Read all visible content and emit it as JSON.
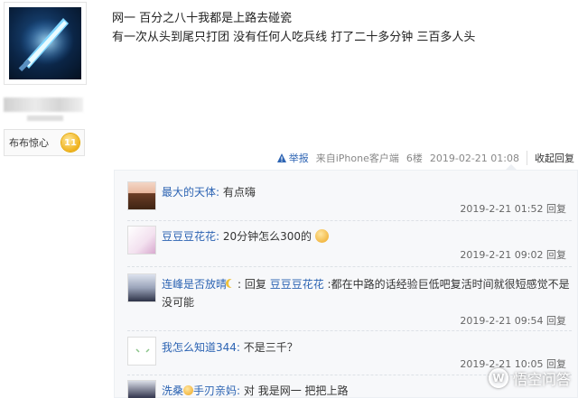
{
  "sidebar": {
    "fan_badge_label": "布布惊心",
    "fan_level": "11"
  },
  "post": {
    "lines": [
      "网一 百分之八十我都是上路去碰瓷",
      "有一次从头到尾只打团 没有任何人吃兵线 打了二十多分钟 三百多人头"
    ],
    "meta": {
      "report_label": "举报",
      "source": "来自iPhone客户端",
      "floor": "6楼",
      "time": "2019-02-21 01:08",
      "collapse_label": "收起回复"
    }
  },
  "replies": [
    {
      "user": "最大的天体:",
      "text": "有点嗨",
      "time": "2019-2-21 01:52",
      "reply_label": "回复"
    },
    {
      "user": "豆豆豆花花:",
      "text": "20分钟怎么300的",
      "time": "2019-2-21 09:02",
      "reply_label": "回复"
    },
    {
      "user": "连峰是否放晴",
      "prefix": ": 回复 ",
      "target": "豆豆豆花花",
      "text": " :都在中路的话经验巨低吧复活时间就很短感觉不是没可能",
      "time": "2019-2-21 09:54",
      "reply_label": "回复"
    },
    {
      "user": "我怎么知道344:",
      "text": "不是三千？",
      "time": "2019-2-21 10:05",
      "reply_label": "回复"
    },
    {
      "user": "洗桑",
      "user_suffix": "手刃亲妈:",
      "text": " 对 我是网一 把把上路"
    }
  ],
  "watermark": {
    "text": "悟空问答",
    "icon_glyph": "W"
  },
  "colors": {
    "link": "#2d64b3",
    "reply_bg": "#f7f8fa",
    "badge": "#f0b21c"
  }
}
